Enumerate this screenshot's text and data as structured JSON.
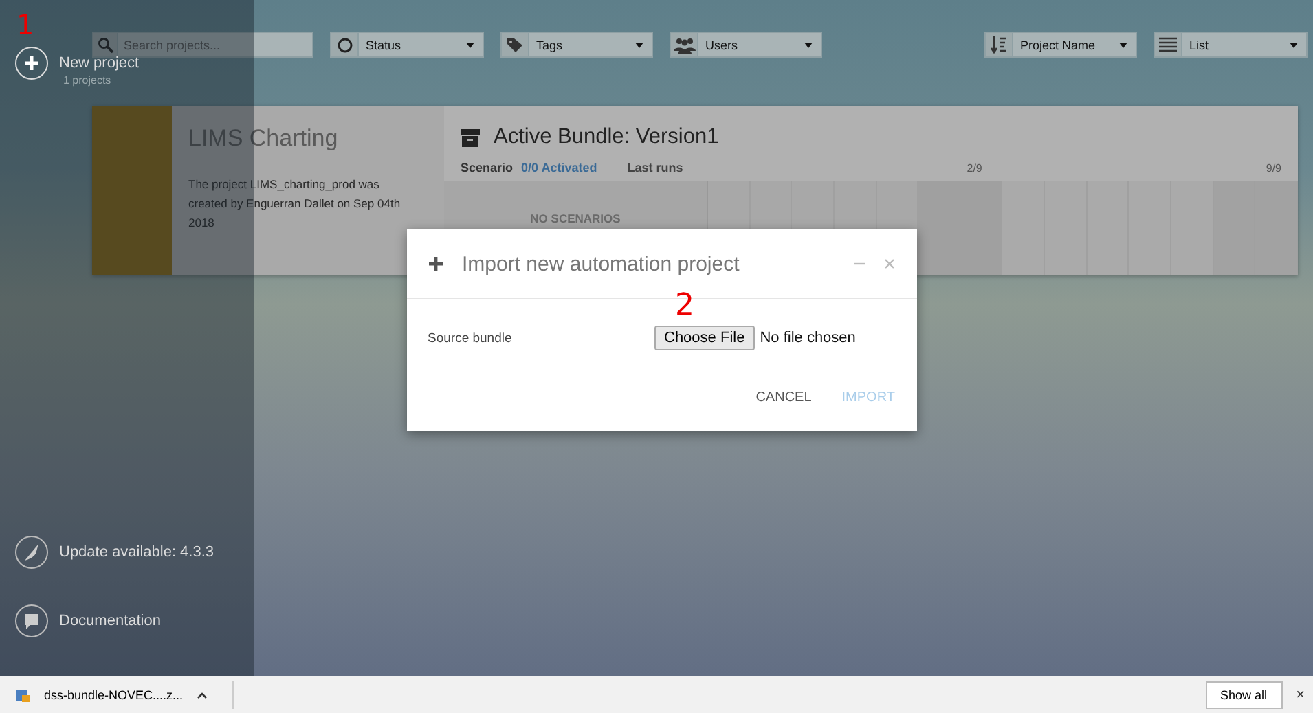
{
  "sidebar": {
    "new_project": "New project",
    "project_count": "1 projects",
    "update": "Update available: 4.3.3",
    "documentation": "Documentation"
  },
  "filters": {
    "search": {
      "placeholder": "Search projects..."
    },
    "dropdowns": [
      {
        "kind": "status",
        "label": "Status"
      },
      {
        "kind": "tags",
        "label": "Tags"
      },
      {
        "kind": "users",
        "label": "Users"
      },
      {
        "kind": "sort",
        "label": "Project Name"
      },
      {
        "kind": "view",
        "label": "List"
      }
    ]
  },
  "project": {
    "title": "LIMS Charting",
    "description": "The project LIMS_charting_prod was created by Enguerran Dallet on Sep 04th 2018",
    "bundle_title": "Active Bundle: Version1",
    "scenario_label": "Scenario",
    "activated": "0/0 Activated",
    "last_runs": "Last runs",
    "run_ticks": [
      "2/9",
      "9/9"
    ],
    "no_scenarios": "NO SCENARIOS"
  },
  "dialog": {
    "title": "Import new automation project",
    "field_label": "Source bundle",
    "choose_button": "Choose File",
    "file_status": "No file chosen",
    "buttons": [
      {
        "label": "CANCEL",
        "disabled": false
      },
      {
        "label": "IMPORT",
        "disabled": true
      }
    ]
  },
  "annotations": [
    {
      "text": "1"
    },
    {
      "text": "2"
    }
  ],
  "download_bar": {
    "file": "dss-bundle-NOVEC....z...",
    "show_all": "Show all",
    "close": "×"
  }
}
